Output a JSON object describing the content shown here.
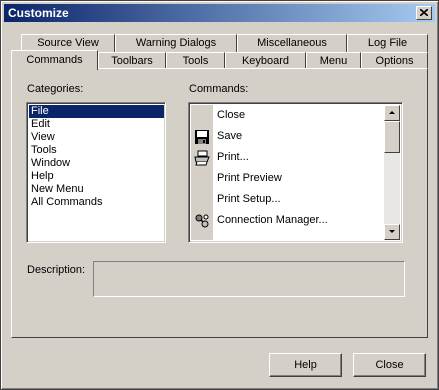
{
  "window": {
    "title": "Customize"
  },
  "tabs_back": [
    "Source View",
    "Warning Dialogs",
    "Miscellaneous",
    "Log File"
  ],
  "tabs_front": [
    "Commands",
    "Toolbars",
    "Tools",
    "Keyboard",
    "Menu",
    "Options"
  ],
  "active_tab": "Commands",
  "categories": {
    "label": "Categories:",
    "items": [
      "File",
      "Edit",
      "View",
      "Tools",
      "Window",
      "Help",
      "New Menu",
      "All Commands"
    ],
    "selected": "File"
  },
  "commands": {
    "label": "Commands:",
    "items": [
      {
        "label": "Close",
        "icon": ""
      },
      {
        "label": "Save",
        "icon": "floppy-disk-icon"
      },
      {
        "label": "Print...",
        "icon": "printer-icon"
      },
      {
        "label": "Print Preview",
        "icon": ""
      },
      {
        "label": "Print Setup...",
        "icon": ""
      },
      {
        "label": "Connection Manager...",
        "icon": "connection-manager-icon"
      }
    ]
  },
  "description": {
    "label": "Description:",
    "value": ""
  },
  "buttons": {
    "help": "Help",
    "close": "Close"
  }
}
